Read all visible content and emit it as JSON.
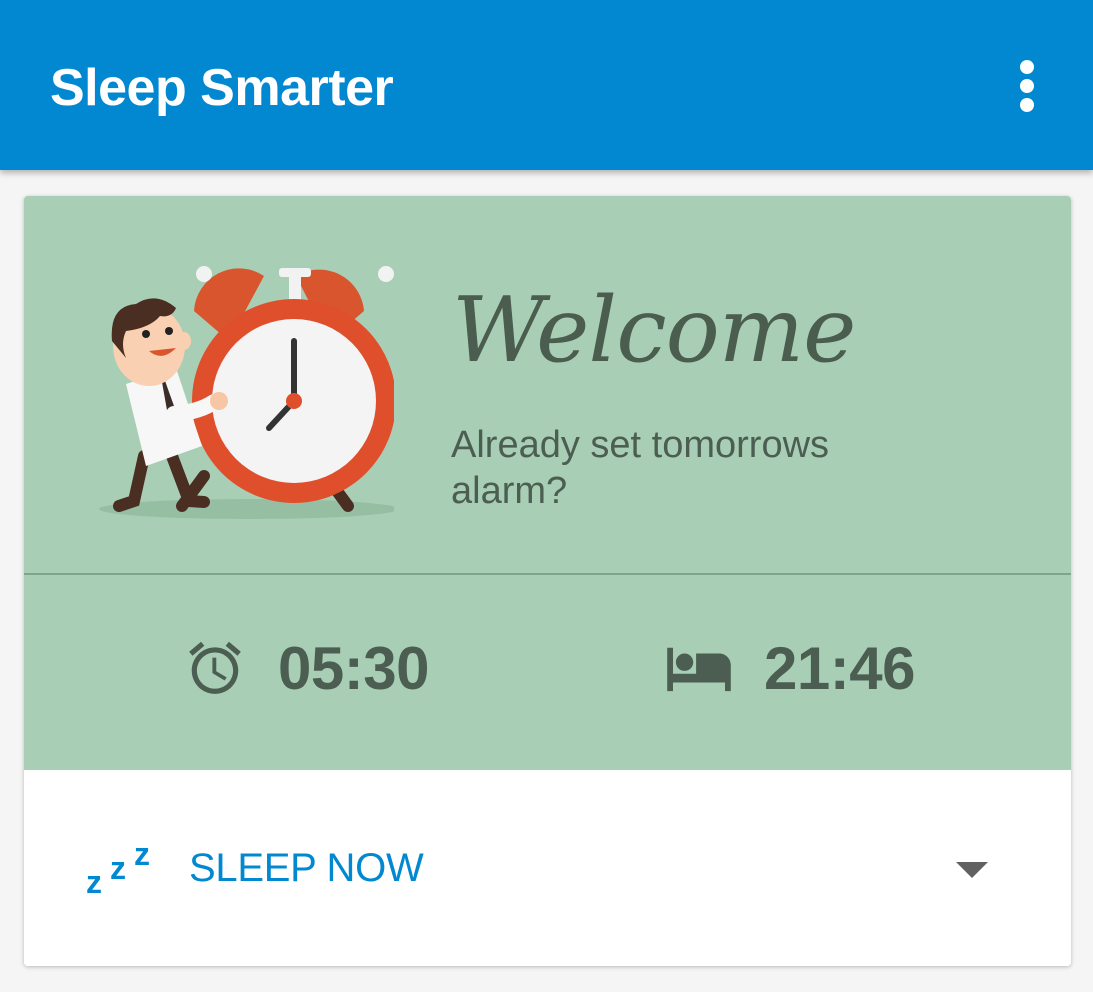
{
  "app_bar": {
    "title": "Sleep Smarter",
    "overflow_icon": "more-vert-icon",
    "background_color": "#0288d1"
  },
  "welcome_card": {
    "illustration": "man-with-alarm-clock-illustration",
    "heading": "Welcome",
    "subtitle": "Already set tomorrows alarm?",
    "background_color": "#a8cfb5",
    "alarm": {
      "icon": "alarm-clock-icon",
      "time": "05:30"
    },
    "bedtime": {
      "icon": "bed-icon",
      "time": "21:46"
    }
  },
  "action": {
    "icon": "zzz-icon",
    "label": "SLEEP NOW",
    "dropdown_icon": "arrow-drop-down-icon",
    "accent_color": "#0288d1"
  }
}
